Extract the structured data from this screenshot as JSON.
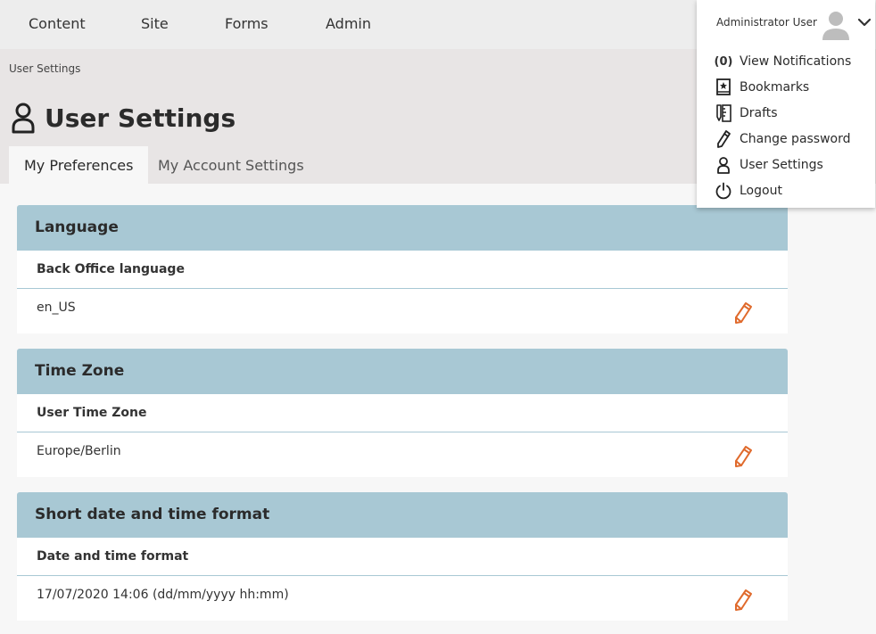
{
  "nav": {
    "items": [
      {
        "label": "Content"
      },
      {
        "label": "Site"
      },
      {
        "label": "Forms"
      },
      {
        "label": "Admin"
      }
    ]
  },
  "breadcrumb": "User Settings",
  "page_title": "User Settings",
  "tabs": [
    {
      "label": "My Preferences",
      "active": true
    },
    {
      "label": "My Account Settings",
      "active": false
    }
  ],
  "panels": [
    {
      "title": "Language",
      "label": "Back Office language",
      "value": "en_US"
    },
    {
      "title": "Time Zone",
      "label": "User Time Zone",
      "value": "Europe/Berlin"
    },
    {
      "title": "Short date and time format",
      "label": "Date and time format",
      "value": "17/07/2020 14:06 (dd/mm/yyyy hh:mm)"
    }
  ],
  "user_menu": {
    "user_name": "Administrator User",
    "notification_count": "(0)",
    "items": [
      {
        "label": "View Notifications",
        "icon": "notification-count"
      },
      {
        "label": "Bookmarks",
        "icon": "bookmark-icon"
      },
      {
        "label": "Drafts",
        "icon": "drafts-icon"
      },
      {
        "label": "Change password",
        "icon": "pencil-icon"
      },
      {
        "label": "User Settings",
        "icon": "user-icon"
      },
      {
        "label": "Logout",
        "icon": "power-icon"
      }
    ]
  },
  "colors": {
    "panel_header": "#a8c8d4",
    "edit_icon": "#e06a2c",
    "topbar": "#ededed"
  }
}
